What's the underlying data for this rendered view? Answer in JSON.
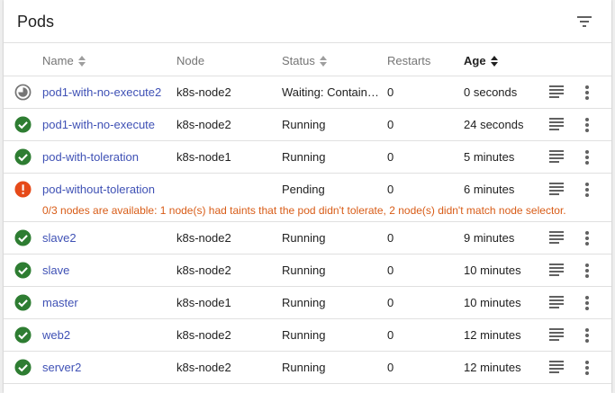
{
  "card": {
    "title": "Pods"
  },
  "columns": {
    "name": "Name",
    "node": "Node",
    "status": "Status",
    "restarts": "Restarts",
    "age": "Age"
  },
  "colors": {
    "ok": "#2e7d32",
    "error": "#e64a19",
    "pending": "#757575",
    "link": "#3f51b5",
    "warning_text": "#d85c17"
  },
  "rows": [
    {
      "icon": "pending-icon",
      "name": "pod1-with-no-execute2",
      "node": "k8s-node2",
      "status": "Waiting: ContainerCreating",
      "restarts": "0",
      "age": "0 seconds"
    },
    {
      "icon": "check-circle-icon",
      "name": "pod1-with-no-execute",
      "node": "k8s-node2",
      "status": "Running",
      "restarts": "0",
      "age": "24 seconds"
    },
    {
      "icon": "check-circle-icon",
      "name": "pod-with-toleration",
      "node": "k8s-node1",
      "status": "Running",
      "restarts": "0",
      "age": "5 minutes"
    },
    {
      "icon": "error-icon",
      "name": "pod-without-toleration",
      "node": "",
      "status": "Pending",
      "restarts": "0",
      "age": "6 minutes",
      "message": "0/3 nodes are available: 1 node(s) had taints that the pod didn't tolerate, 2 node(s) didn't match node selector."
    },
    {
      "icon": "check-circle-icon",
      "name": "slave2",
      "node": "k8s-node2",
      "status": "Running",
      "restarts": "0",
      "age": "9 minutes"
    },
    {
      "icon": "check-circle-icon",
      "name": "slave",
      "node": "k8s-node2",
      "status": "Running",
      "restarts": "0",
      "age": "10 minutes"
    },
    {
      "icon": "check-circle-icon",
      "name": "master",
      "node": "k8s-node1",
      "status": "Running",
      "restarts": "0",
      "age": "10 minutes"
    },
    {
      "icon": "check-circle-icon",
      "name": "web2",
      "node": "k8s-node2",
      "status": "Running",
      "restarts": "0",
      "age": "12 minutes"
    },
    {
      "icon": "check-circle-icon",
      "name": "server2",
      "node": "k8s-node2",
      "status": "Running",
      "restarts": "0",
      "age": "12 minutes"
    }
  ]
}
